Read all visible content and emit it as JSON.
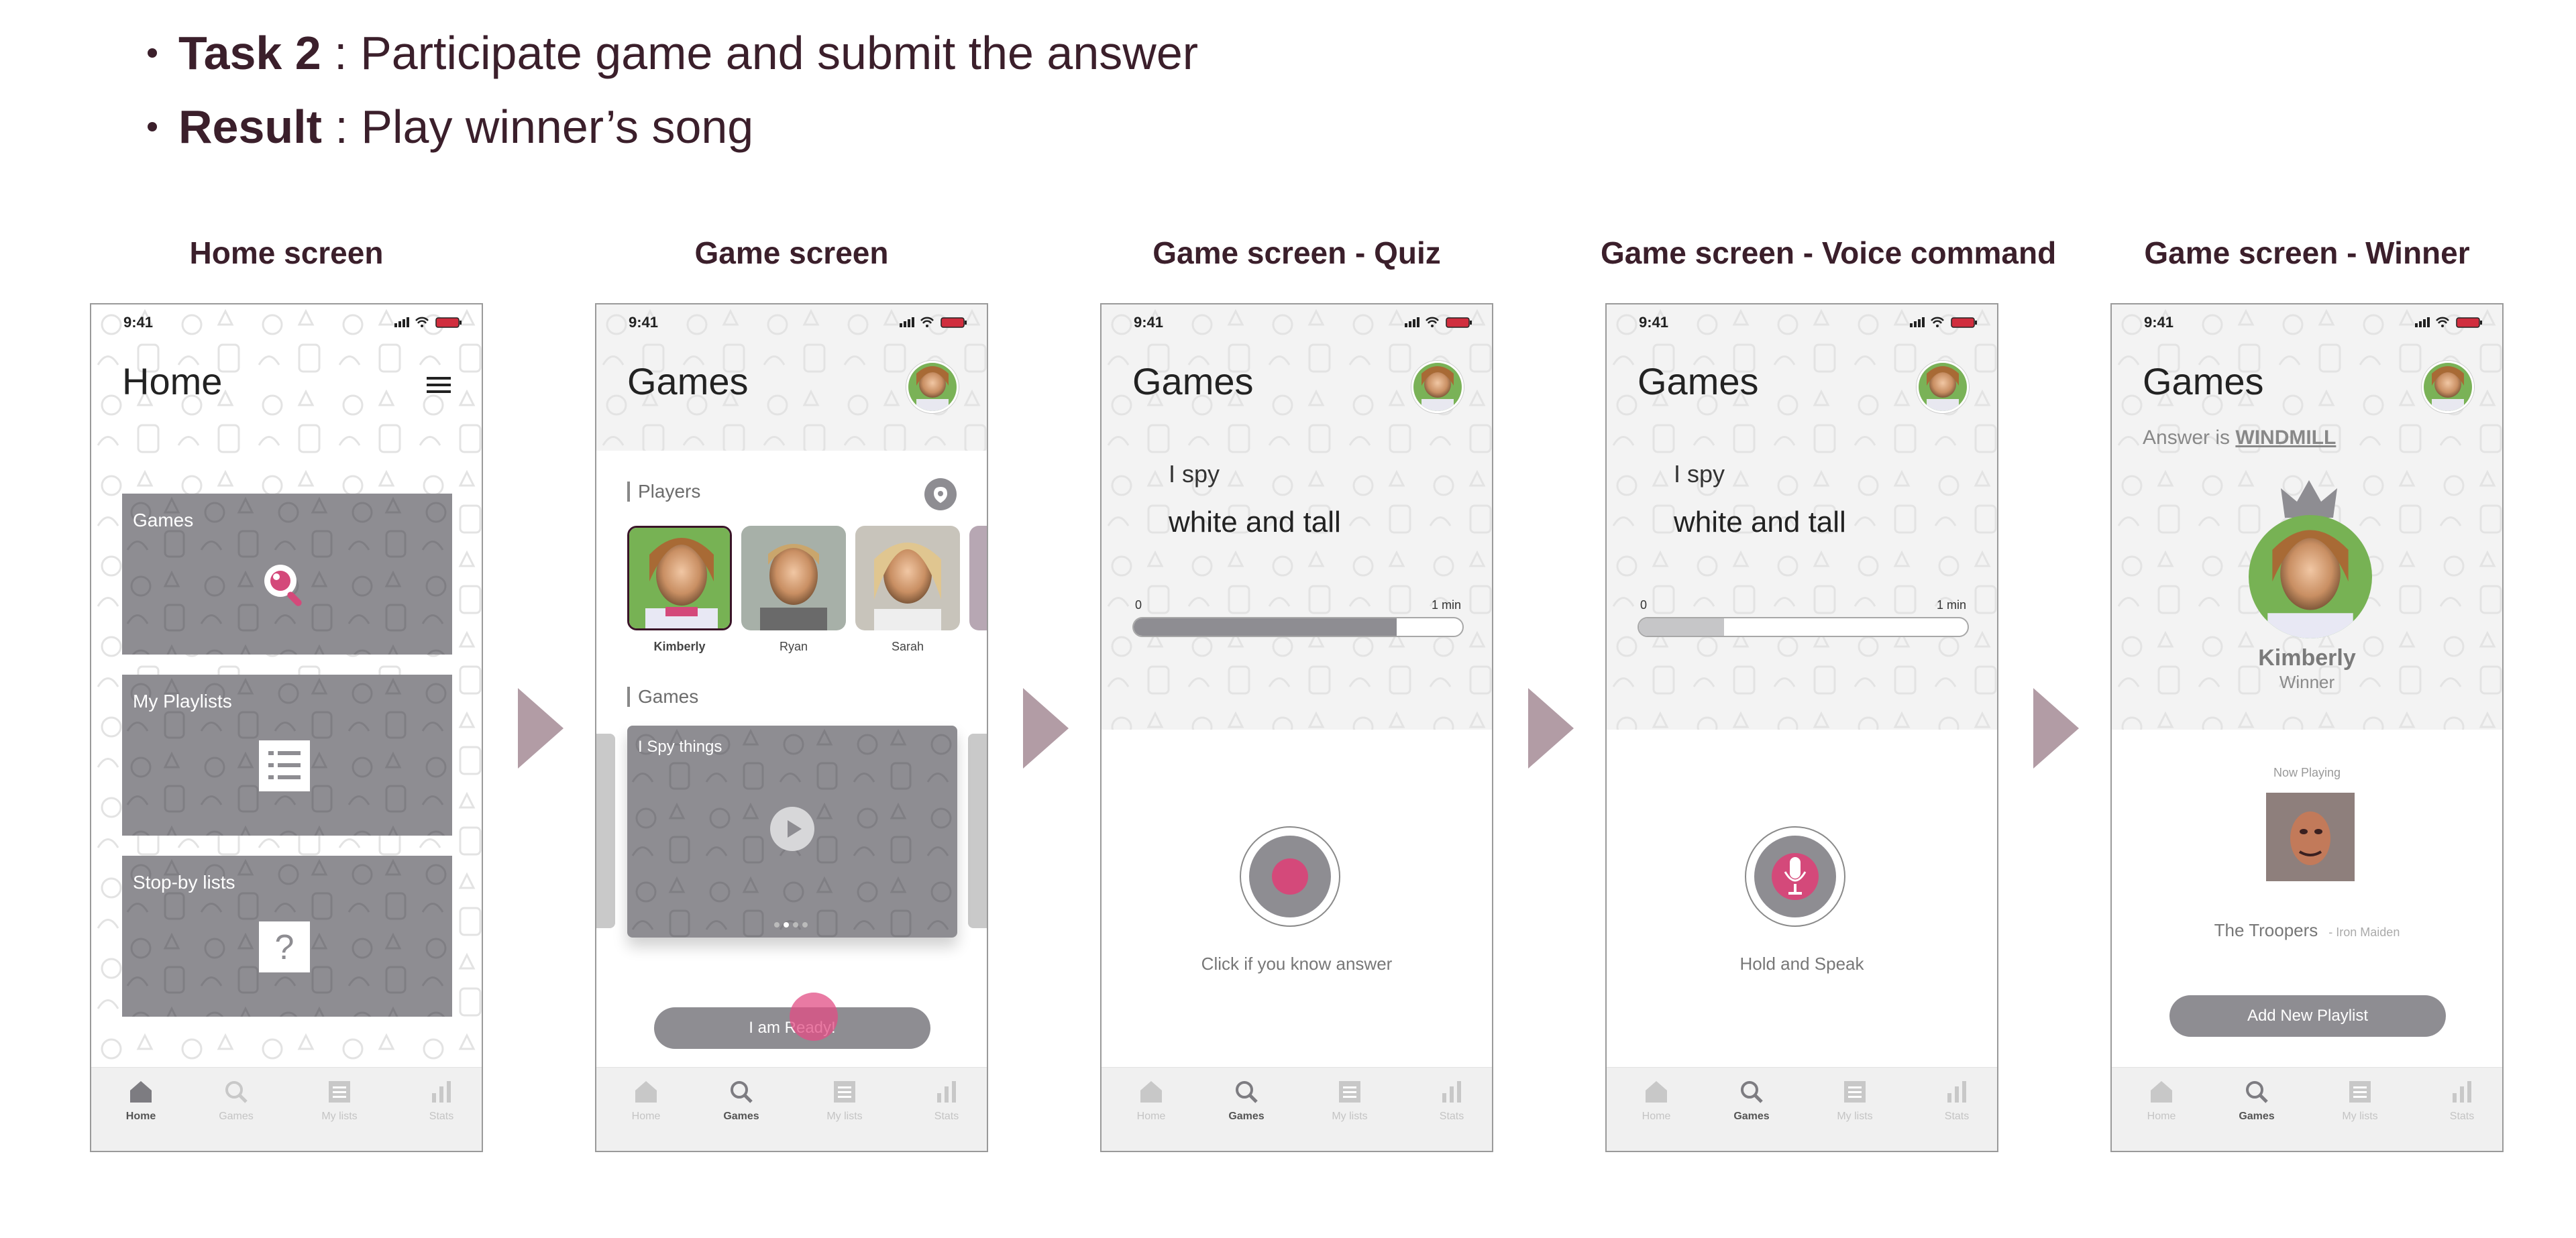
{
  "bullets": [
    {
      "bold": "Task 2",
      "rest": " : Participate game and submit the answer"
    },
    {
      "bold": "Result",
      "rest": " : Play winner’s song"
    }
  ],
  "screen_titles": [
    "Home screen",
    "Game screen",
    "Game screen - Quiz",
    "Game screen - Voice command",
    "Game screen - Winner"
  ],
  "status_time": "9:41",
  "tabs": [
    "Home",
    "Games",
    "My lists",
    "Stats"
  ],
  "home": {
    "title": "Home",
    "cards": [
      "Games",
      "My Playlists",
      "Stop-by lists"
    ]
  },
  "games": {
    "title": "Games",
    "players_label": "Players",
    "players": [
      "Kimberly",
      "Ryan",
      "Sarah"
    ],
    "games_label": "Games",
    "game_card": "I Spy things",
    "ready_button": "I am Ready!"
  },
  "quiz": {
    "title": "Games",
    "line1": "I spy",
    "line2": "white and tall",
    "time_start": "0",
    "time_end": "1 min",
    "progress": 0.8,
    "hint": "Click if you know answer"
  },
  "voice": {
    "title": "Games",
    "line1": "I spy",
    "line2": "white and tall",
    "time_start": "0",
    "time_end": "1 min",
    "progress": 0.26,
    "hint": "Hold and Speak"
  },
  "winner": {
    "title": "Games",
    "answer_prefix": "Answer is ",
    "answer": "WINDMILL",
    "name": "Kimberly",
    "role": "Winner",
    "now_playing": "Now Playing",
    "song": "The Troopers",
    "artist": "- Iron Maiden",
    "add_button": "Add New Playlist"
  },
  "colors": {
    "accent": "#d4497a",
    "card_gray": "#8e8d92",
    "arrow": "#b29ca5",
    "text_dark": "#3b1f2b"
  }
}
